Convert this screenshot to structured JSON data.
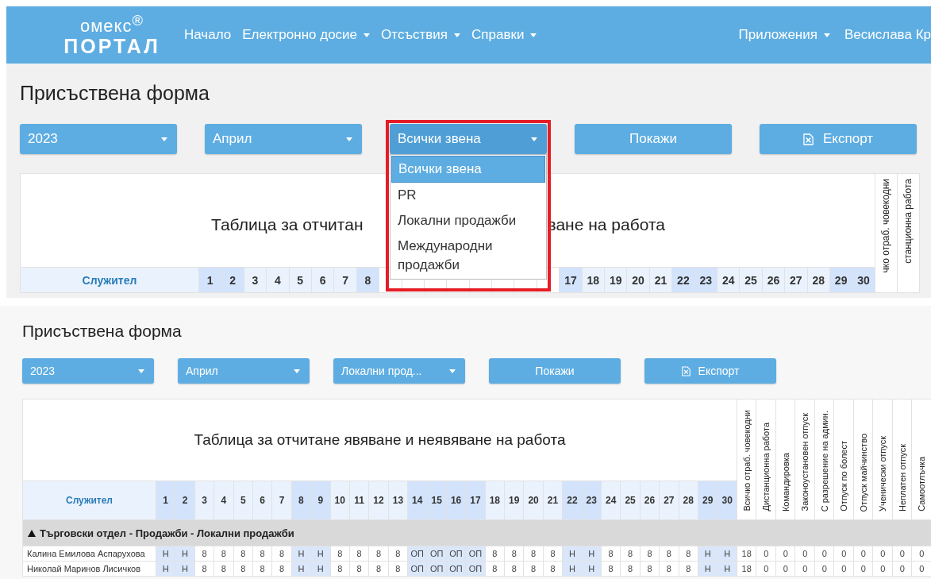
{
  "navbar": {
    "logo_top": "омекс$^{®}$",
    "logo_bottom": "ПОРТАЛ",
    "menu": [
      {
        "label": "Начало",
        "dropdown": false
      },
      {
        "label": "Електронно досие",
        "dropdown": true
      },
      {
        "label": "Отсъствия",
        "dropdown": true
      },
      {
        "label": "Справки",
        "dropdown": true
      }
    ],
    "right_menu": [
      {
        "label": "Приложения",
        "dropdown": true
      },
      {
        "label": "Весислава Кр",
        "dropdown": false
      }
    ]
  },
  "panels": [
    {
      "title": "Присъствена форма",
      "filters": [
        {
          "kind": "select",
          "value": "2023"
        },
        {
          "kind": "select",
          "value": "Април"
        },
        {
          "kind": "select",
          "value": "Всички звена",
          "open": true,
          "highlighted": true,
          "options": [
            {
              "label": "Всички звена",
              "selected": true
            },
            {
              "label": "PR",
              "selected": false
            },
            {
              "label": "Локални продажби",
              "selected": false
            },
            {
              "label": "Международни продажби",
              "selected": false
            }
          ]
        },
        {
          "kind": "button",
          "label": "Покажи"
        },
        {
          "kind": "button",
          "label": "Експорт",
          "icon": true
        }
      ],
      "table": {
        "title": [
          "Таблица за отчитан",
          "ване на работа"
        ],
        "employee_header": "Служител",
        "days": [
          {
            "label": "1",
            "highlighted": true
          },
          {
            "label": "2",
            "highlighted": true
          },
          {
            "label": "3",
            "highlighted": false
          },
          {
            "label": "4",
            "highlighted": false
          },
          {
            "label": "5",
            "highlighted": false
          },
          {
            "label": "6",
            "highlighted": false
          },
          {
            "label": "7",
            "highlighted": false
          },
          {
            "label": "8",
            "highlighted": true
          },
          {
            "kind": "covered"
          },
          {
            "kind": "covered"
          },
          {
            "kind": "covered"
          },
          {
            "kind": "covered"
          },
          {
            "kind": "covered"
          },
          {
            "kind": "covered"
          },
          {
            "kind": "covered"
          },
          {
            "kind": "covered"
          },
          {
            "label": "17",
            "highlighted": true
          },
          {
            "label": "18",
            "highlighted": false
          },
          {
            "label": "19",
            "highlighted": false
          },
          {
            "label": "20",
            "highlighted": false
          },
          {
            "label": "21",
            "highlighted": false
          },
          {
            "label": "22",
            "highlighted": true
          },
          {
            "label": "23",
            "highlighted": true
          },
          {
            "label": "24",
            "highlighted": false
          },
          {
            "label": "25",
            "highlighted": false
          },
          {
            "label": "26",
            "highlighted": false
          },
          {
            "label": "27",
            "highlighted": false
          },
          {
            "label": "28",
            "highlighted": false
          },
          {
            "label": "29",
            "highlighted": true
          },
          {
            "label": "30",
            "highlighted": true
          }
        ],
        "summary_headers": [
          "чко отраб. човекодни",
          "станционна работа"
        ]
      }
    },
    {
      "title": "Присъствена форма",
      "filters": [
        {
          "kind": "select",
          "value": "2023"
        },
        {
          "kind": "select",
          "value": "Април"
        },
        {
          "kind": "select",
          "value": "Локални прод..."
        },
        {
          "kind": "button",
          "label": "Покажи"
        },
        {
          "kind": "button",
          "label": "Експорт",
          "icon": true
        }
      ],
      "table": {
        "title": [
          "Таблица за отчитане явяване и неявяване на работа"
        ],
        "employee_header": "Служител",
        "days": [
          {
            "label": "1",
            "highlighted": true
          },
          {
            "label": "2",
            "highlighted": true
          },
          {
            "label": "3",
            "highlighted": false
          },
          {
            "label": "4",
            "highlighted": false
          },
          {
            "label": "5",
            "highlighted": false
          },
          {
            "label": "6",
            "highlighted": false
          },
          {
            "label": "7",
            "highlighted": false
          },
          {
            "label": "8",
            "highlighted": true
          },
          {
            "label": "9",
            "highlighted": true
          },
          {
            "label": "10",
            "highlighted": false
          },
          {
            "label": "11",
            "highlighted": false
          },
          {
            "label": "12",
            "highlighted": false
          },
          {
            "label": "13",
            "highlighted": false
          },
          {
            "label": "14",
            "highlighted": true
          },
          {
            "label": "15",
            "highlighted": true
          },
          {
            "label": "16",
            "highlighted": true
          },
          {
            "label": "17",
            "highlighted": true
          },
          {
            "label": "18",
            "highlighted": false
          },
          {
            "label": "19",
            "highlighted": false
          },
          {
            "label": "20",
            "highlighted": false
          },
          {
            "label": "21",
            "highlighted": false
          },
          {
            "label": "22",
            "highlighted": true
          },
          {
            "label": "23",
            "highlighted": true
          },
          {
            "label": "24",
            "highlighted": false
          },
          {
            "label": "25",
            "highlighted": false
          },
          {
            "label": "26",
            "highlighted": false
          },
          {
            "label": "27",
            "highlighted": false
          },
          {
            "label": "28",
            "highlighted": false
          },
          {
            "label": "29",
            "highlighted": true
          },
          {
            "label": "30",
            "highlighted": true
          }
        ],
        "summary_headers": [
          "Всичко отраб. човекодни",
          "Дистанционна работа",
          "Командировка",
          "Законоустановен отпуск",
          "С разрешение на админ.",
          "Отпуск по болест",
          "Отпуск майчинство",
          "Ученически отпуск",
          "Неплатен отпуск",
          "Самоотлъчка"
        ],
        "group": {
          "label": "Търговски отдел - Продажби - Локални продажби",
          "expanded": true
        },
        "rows": [
          {
            "name": "Калина Емилова Аспарухова",
            "cells": [
              "Н",
              "Н",
              "8",
              "8",
              "8",
              "8",
              "8",
              "Н",
              "Н",
              "8",
              "8",
              "8",
              "8",
              "ОП",
              "ОП",
              "ОП",
              "ОП",
              "8",
              "8",
              "8",
              "8",
              "Н",
              "Н",
              "8",
              "8",
              "8",
              "8",
              "8",
              "Н",
              "Н"
            ],
            "totals": [
              "18",
              "0",
              "0",
              "0",
              "0",
              "0",
              "0",
              "0",
              "0",
              "0"
            ]
          },
          {
            "name": "Николай Маринов Лисичков",
            "cells": [
              "Н",
              "Н",
              "8",
              "8",
              "8",
              "8",
              "8",
              "Н",
              "Н",
              "8",
              "8",
              "8",
              "8",
              "ОП",
              "ОП",
              "ОП",
              "ОП",
              "8",
              "8",
              "8",
              "8",
              "Н",
              "Н",
              "8",
              "8",
              "8",
              "8",
              "8",
              "Н",
              "Н"
            ],
            "totals": [
              "18",
              "0",
              "0",
              "0",
              "0",
              "0",
              "0",
              "0",
              "0",
              "0"
            ]
          }
        ]
      }
    }
  ]
}
